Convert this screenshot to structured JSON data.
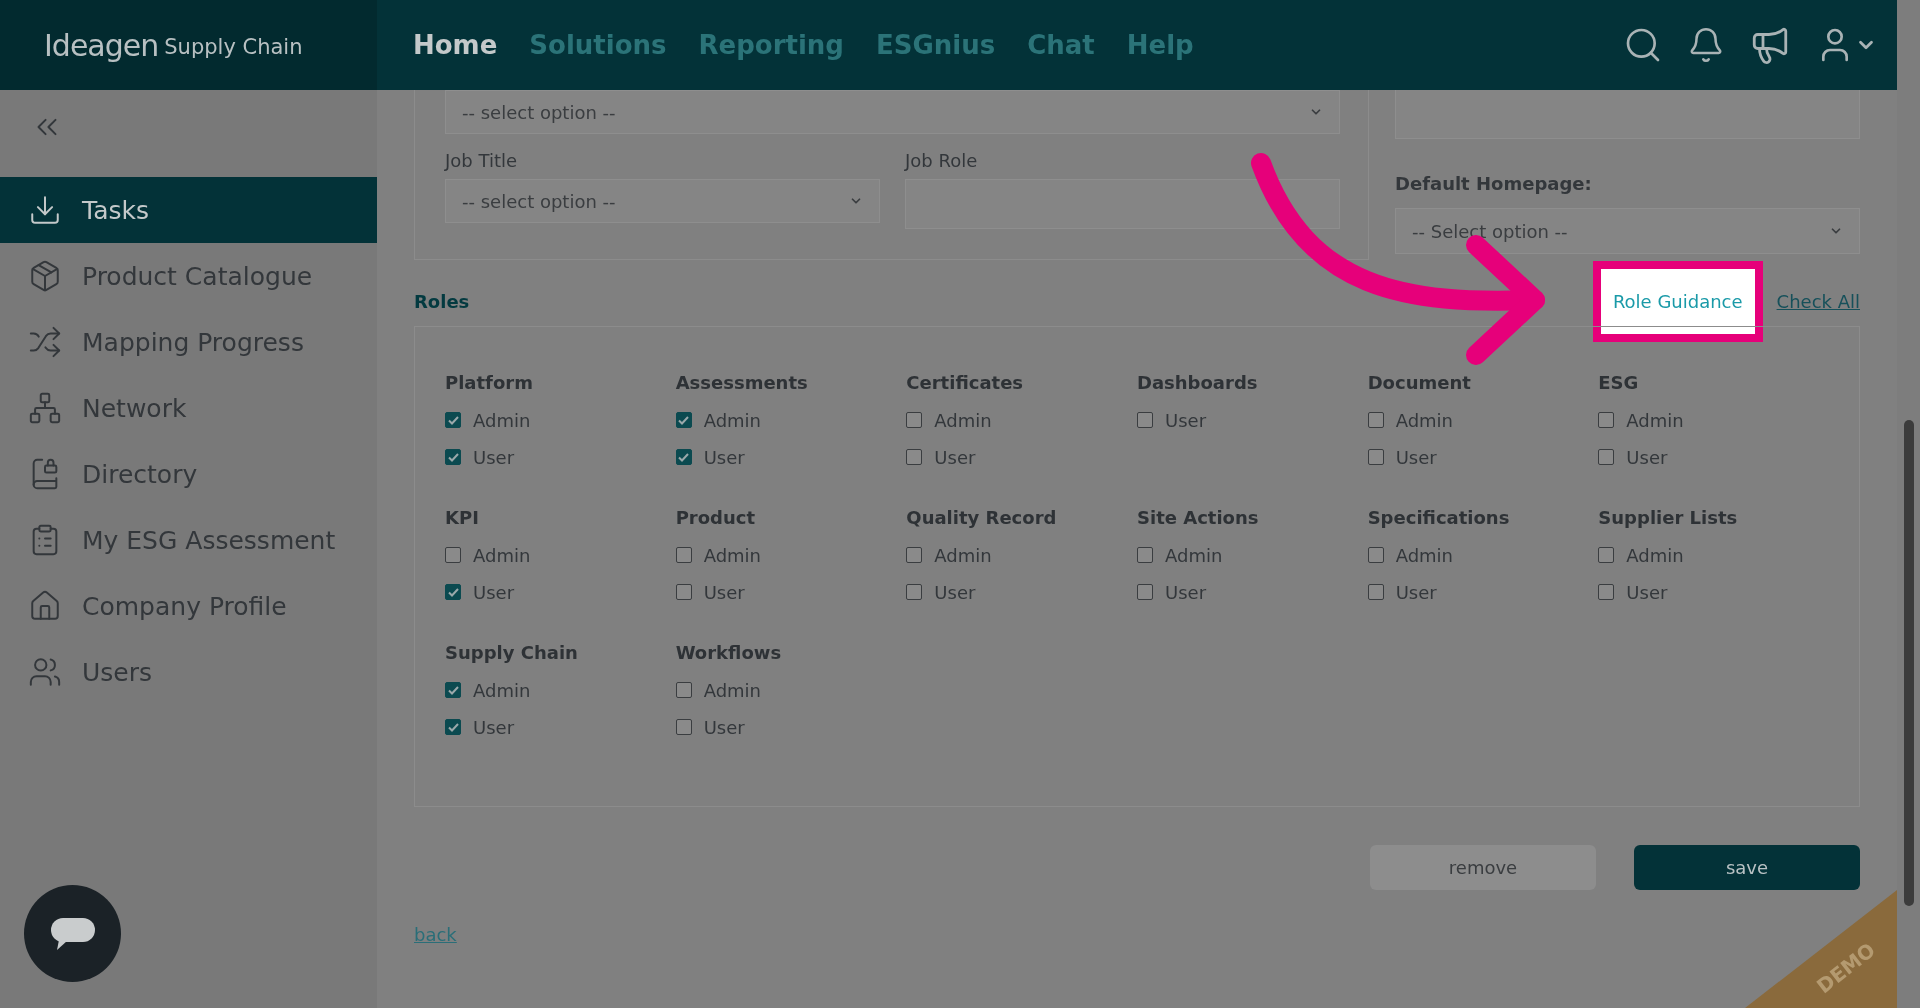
{
  "header": {
    "logo": {
      "brand": "Ideagen",
      "product": "Supply Chain"
    },
    "nav": [
      {
        "label": "Home",
        "selected": true
      },
      {
        "label": "Solutions",
        "selected": false
      },
      {
        "label": "Reporting",
        "selected": false
      },
      {
        "label": "ESGnius",
        "selected": false
      },
      {
        "label": "Chat",
        "selected": false
      },
      {
        "label": "Help",
        "selected": false
      }
    ]
  },
  "sidebar": {
    "items": [
      {
        "label": "Tasks",
        "selected": true
      },
      {
        "label": "Product Catalogue",
        "selected": false
      },
      {
        "label": "Mapping Progress",
        "selected": false
      },
      {
        "label": "Network",
        "selected": false
      },
      {
        "label": "Directory",
        "selected": false
      },
      {
        "label": "My ESG Assessment",
        "selected": false
      },
      {
        "label": "Company Profile",
        "selected": false
      },
      {
        "label": "Users",
        "selected": false
      }
    ]
  },
  "form": {
    "top_select": {
      "value": "-- select option --"
    },
    "job_title": {
      "label": "Job Title",
      "value": "-- select option --"
    },
    "job_role": {
      "label": "Job Role"
    },
    "default_homepage": {
      "label": "Default Homepage:",
      "value": "-- Select option --"
    }
  },
  "roles": {
    "title": "Roles",
    "guidance": "Role Guidance",
    "check_all": "Check All",
    "groups": [
      {
        "name": "Platform",
        "options": [
          {
            "label": "Admin",
            "checked": true
          },
          {
            "label": "User",
            "checked": true
          }
        ]
      },
      {
        "name": "Assessments",
        "options": [
          {
            "label": "Admin",
            "checked": true
          },
          {
            "label": "User",
            "checked": true
          }
        ]
      },
      {
        "name": "Certificates",
        "options": [
          {
            "label": "Admin",
            "checked": false
          },
          {
            "label": "User",
            "checked": false
          }
        ]
      },
      {
        "name": "Dashboards",
        "options": [
          {
            "label": "User",
            "checked": false
          }
        ]
      },
      {
        "name": "Document",
        "options": [
          {
            "label": "Admin",
            "checked": false
          },
          {
            "label": "User",
            "checked": false
          }
        ]
      },
      {
        "name": "ESG",
        "options": [
          {
            "label": "Admin",
            "checked": false
          },
          {
            "label": "User",
            "checked": false
          }
        ]
      },
      {
        "name": "KPI",
        "options": [
          {
            "label": "Admin",
            "checked": false
          },
          {
            "label": "User",
            "checked": true
          }
        ]
      },
      {
        "name": "Product",
        "options": [
          {
            "label": "Admin",
            "checked": false
          },
          {
            "label": "User",
            "checked": false
          }
        ]
      },
      {
        "name": "Quality Record",
        "options": [
          {
            "label": "Admin",
            "checked": false
          },
          {
            "label": "User",
            "checked": false
          }
        ]
      },
      {
        "name": "Site Actions",
        "options": [
          {
            "label": "Admin",
            "checked": false
          },
          {
            "label": "User",
            "checked": false
          }
        ]
      },
      {
        "name": "Specifications",
        "options": [
          {
            "label": "Admin",
            "checked": false
          },
          {
            "label": "User",
            "checked": false
          }
        ]
      },
      {
        "name": "Supplier Lists",
        "options": [
          {
            "label": "Admin",
            "checked": false
          },
          {
            "label": "User",
            "checked": false
          }
        ]
      },
      {
        "name": "Supply Chain",
        "options": [
          {
            "label": "Admin",
            "checked": true
          },
          {
            "label": "User",
            "checked": true
          }
        ]
      },
      {
        "name": "Workflows",
        "options": [
          {
            "label": "Admin",
            "checked": false
          },
          {
            "label": "User",
            "checked": false
          }
        ]
      }
    ]
  },
  "actions": {
    "remove": "remove",
    "save": "save",
    "back": "back"
  },
  "ribbon": "DEMO"
}
